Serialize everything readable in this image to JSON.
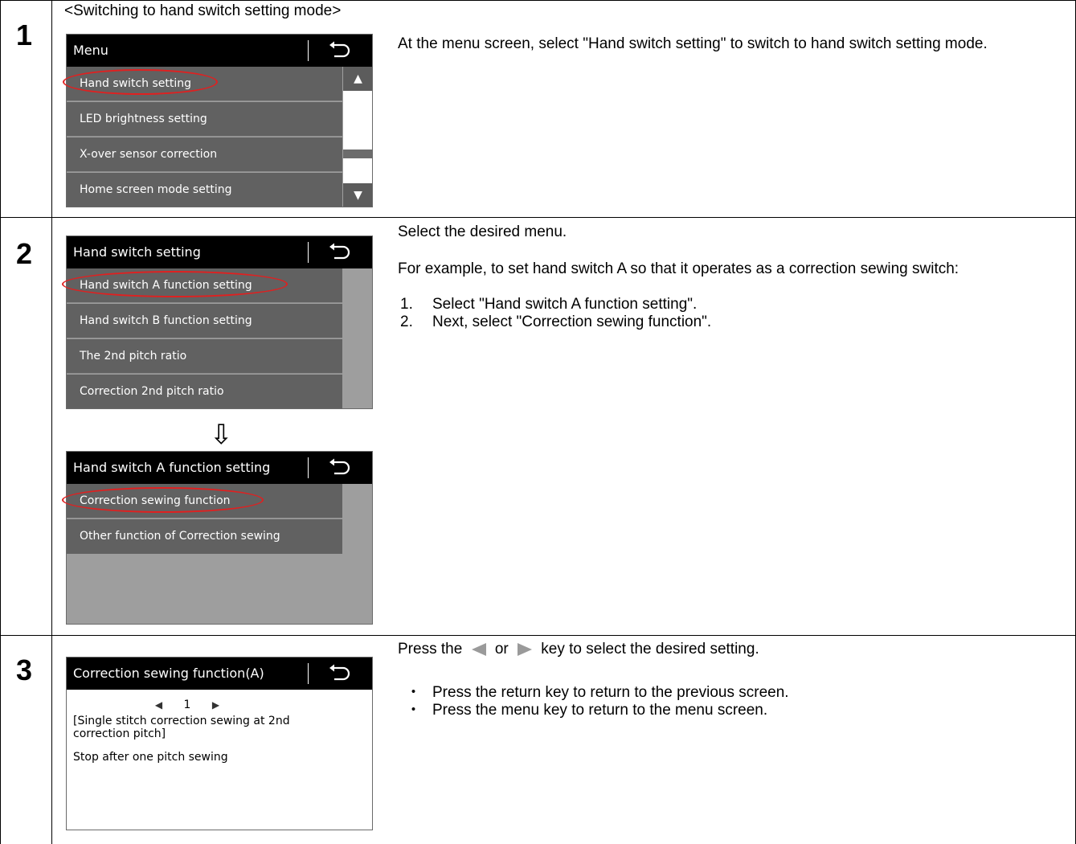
{
  "steps": [
    {
      "number": "1",
      "heading": "<Switching to hand switch setting mode>",
      "description": "At the menu screen, select \"Hand switch setting\" to switch to hand switch setting mode.",
      "screen": {
        "title": "Menu",
        "items": [
          "Hand switch setting",
          "LED brightness setting",
          "X-over sensor correction",
          "Home screen mode setting"
        ],
        "scroll_up": "▲",
        "scroll_down": "▼"
      }
    },
    {
      "number": "2",
      "intro": "Select the desired menu.",
      "example": "For example, to set hand switch A so that it operates as a correction sewing switch:",
      "list": [
        {
          "num": "1.",
          "text": "Select \"Hand switch A function setting\"."
        },
        {
          "num": "2.",
          "text": "Next, select \"Correction sewing function\"."
        }
      ],
      "screen_a": {
        "title": "Hand switch setting",
        "items": [
          "Hand switch A function setting",
          "Hand switch B function setting",
          "The 2nd pitch ratio",
          "Correction 2nd pitch ratio"
        ]
      },
      "arrow": "⇩",
      "screen_b": {
        "title": "Hand switch A function setting",
        "items": [
          "Correction sewing function",
          "Other function of Correction sewing"
        ]
      }
    },
    {
      "number": "3",
      "instruction_before": "Press the",
      "instruction_or": "or",
      "instruction_after": "key to select the desired setting.",
      "bullets": [
        "Press the return key to return to the previous screen.",
        "Press the menu key to return to the menu screen."
      ],
      "bullet_mark": "・",
      "screen": {
        "title": "Correction sewing function(A)",
        "left_arrow": "◀",
        "value": "1",
        "right_arrow": "▶",
        "setting_name": "[Single stitch correction sewing at 2nd correction pitch]",
        "note": "Stop after one pitch sewing"
      }
    }
  ],
  "colors": {
    "highlight_circle": "#e02020",
    "screen_header": "#000000",
    "menu_item": "#616161",
    "screen_bg": "#9e9e9e",
    "key_triangle": "#9a9a9a"
  }
}
